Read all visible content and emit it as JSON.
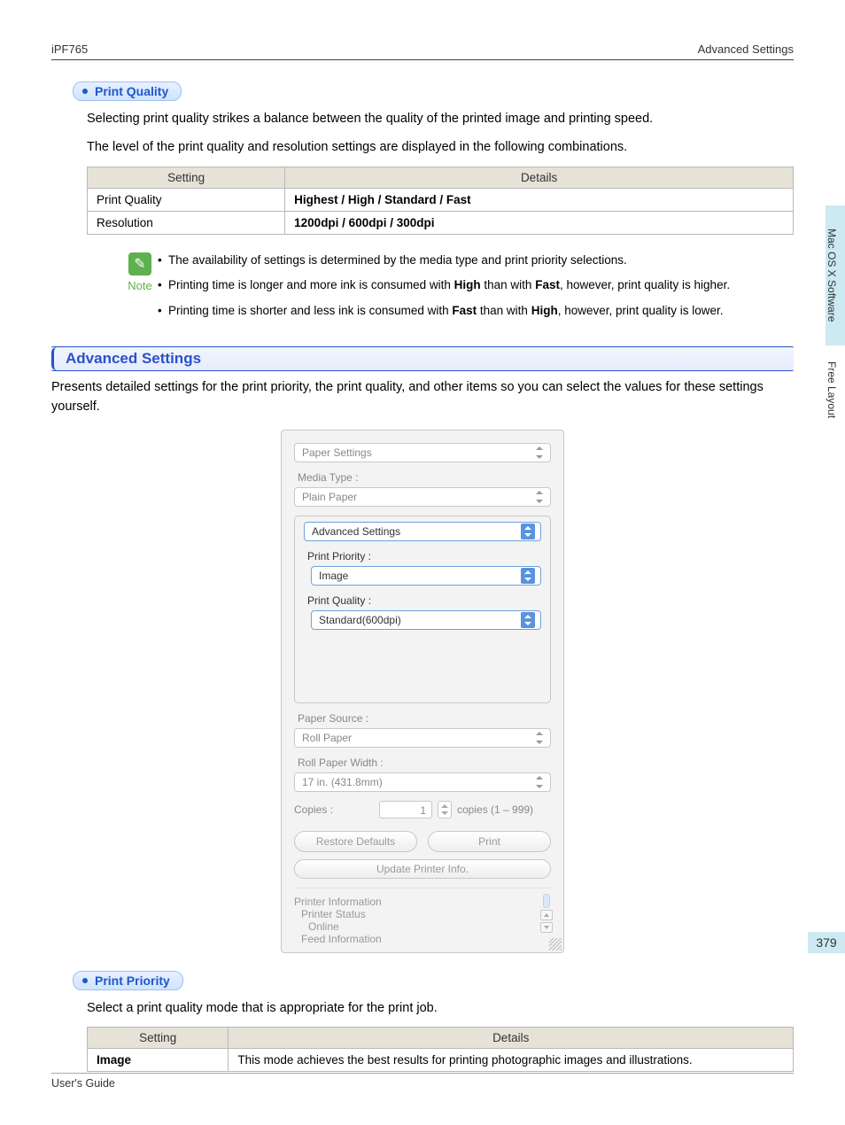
{
  "header": {
    "left": "iPF765",
    "right": "Advanced Settings"
  },
  "print_quality": {
    "head": "Print Quality",
    "p1": "Selecting print quality strikes a balance between the quality of the printed image and printing speed.",
    "p2": "The level of the print quality and resolution settings are displayed in the following combinations.",
    "table": {
      "th1": "Setting",
      "th2": "Details",
      "r1c1": "Print Quality",
      "r1c2": "Highest / High / Standard / Fast",
      "r2c1": "Resolution",
      "r2c2": "1200dpi / 600dpi / 300dpi"
    },
    "note": {
      "label": "Note",
      "items": [
        "The availability of settings is determined by the media type and print priority selections.",
        [
          "Printing time is longer and more ink is consumed with ",
          "High",
          " than with ",
          "Fast",
          ", however, print quality is higher."
        ],
        [
          "Printing time is shorter and less ink is consumed with ",
          "Fast",
          " than with ",
          "High",
          ", however, print quality is lower."
        ]
      ]
    }
  },
  "advanced": {
    "title": "Advanced Settings",
    "p": "Presents detailed settings for the print priority, the print quality, and other items so you can select the values for these settings yourself."
  },
  "dialog": {
    "top_combo": "Paper Settings",
    "media_type_label": "Media Type :",
    "media_type_value": "Plain Paper",
    "group_legend": "Advanced Settings",
    "print_priority_label": "Print Priority :",
    "print_priority_value": "Image",
    "print_quality_label": "Print Quality :",
    "print_quality_value": "Standard(600dpi)",
    "paper_source_label": "Paper Source :",
    "paper_source_value": "Roll Paper",
    "roll_width_label": "Roll Paper Width :",
    "roll_width_value": "17 in. (431.8mm)",
    "copies_label": "Copies :",
    "copies_value": "1",
    "copies_range": "copies (1 – 999)",
    "btn_restore": "Restore Defaults",
    "btn_print": "Print",
    "btn_update": "Update Printer Info.",
    "info_title": "Printer Information",
    "info_status_lbl": "Printer Status",
    "info_status_val": "Online",
    "info_feed": "Feed Information"
  },
  "print_priority": {
    "head": "Print Priority",
    "p": "Select a print quality mode that is appropriate for the print job.",
    "table": {
      "th1": "Setting",
      "th2": "Details",
      "r1c1": "Image",
      "r1c2": "This mode achieves the best results for printing photographic images and illustrations."
    }
  },
  "side": {
    "tab1": "Mac OS X Software",
    "tab2": "Free Layout",
    "page": "379"
  },
  "footer": {
    "left": "User's Guide"
  }
}
